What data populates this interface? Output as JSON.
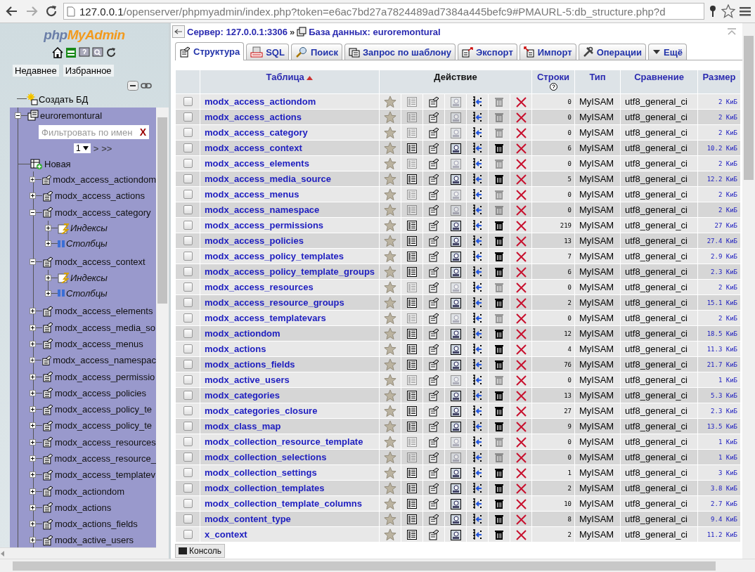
{
  "browser": {
    "url_host": "127.0.0.1",
    "url_path": "/openserver/phpmyadmin/index.php?token=e6ac7bd27a7824489ad7384a445befc9#PMAURL-5:db_structure.php?d"
  },
  "sidebar": {
    "logo_php": "php",
    "logo_myadmin": "MyAdmin",
    "links": [
      "Недавнее",
      "Избранное"
    ],
    "create_db": "Создать БД",
    "database": {
      "label": "euroremontural",
      "expanded": true,
      "filter_placeholder": "Фильтровать по имен",
      "filter_clear": "X",
      "page": "1",
      "page_next": ">",
      "page_last": ">>",
      "new_table": "Новая",
      "tables": [
        {
          "label": "modx_access_actiondom",
          "expanded": false
        },
        {
          "label": "modx_access_actions",
          "expanded": false
        },
        {
          "label": "modx_access_category",
          "expanded": true,
          "children": [
            {
              "label": "Индексы",
              "kind": "indexes",
              "expanded": false
            },
            {
              "label": "Столбцы",
              "kind": "columns",
              "expanded": false
            }
          ]
        },
        {
          "label": "modx_access_context",
          "expanded": true,
          "children": [
            {
              "label": "Индексы",
              "kind": "indexes",
              "expanded": false
            },
            {
              "label": "Столбцы",
              "kind": "columns",
              "expanded": false
            }
          ]
        },
        {
          "label": "modx_access_elements",
          "expanded": false
        },
        {
          "label": "modx_access_media_so",
          "expanded": false
        },
        {
          "label": "modx_access_menus",
          "expanded": false
        },
        {
          "label": "modx_access_namespac",
          "expanded": false
        },
        {
          "label": "modx_access_permissio",
          "expanded": false
        },
        {
          "label": "modx_access_policies",
          "expanded": false
        },
        {
          "label": "modx_access_policy_te",
          "expanded": false
        },
        {
          "label": "modx_access_policy_te",
          "expanded": false
        },
        {
          "label": "modx_access_resources",
          "expanded": false
        },
        {
          "label": "modx_access_resource_",
          "expanded": false
        },
        {
          "label": "modx_access_templatev",
          "expanded": false
        },
        {
          "label": "modx_actiondom",
          "expanded": false
        },
        {
          "label": "modx_actions",
          "expanded": false
        },
        {
          "label": "modx_actions_fields",
          "expanded": false
        },
        {
          "label": "modx_active_users",
          "expanded": false
        }
      ]
    }
  },
  "breadcrumb": {
    "server": "Сервер: 127.0.0.1:3306",
    "separator": "»",
    "database": "База данных: euroremontural"
  },
  "tabs": [
    {
      "label": "Структура",
      "kind": "structure",
      "selected": true
    },
    {
      "label": "SQL",
      "kind": "sql",
      "selected": false
    },
    {
      "label": "Поиск",
      "kind": "search",
      "selected": false
    },
    {
      "label": "Запрос по шаблону",
      "kind": "query",
      "selected": false
    },
    {
      "label": "Экспорт",
      "kind": "export",
      "selected": false
    },
    {
      "label": "Импорт",
      "kind": "import",
      "selected": false
    },
    {
      "label": "Операции",
      "kind": "operations",
      "selected": false
    },
    {
      "label": "Ещё",
      "kind": "more",
      "selected": false
    }
  ],
  "table": {
    "columns": {
      "name": "Таблица",
      "action": "Действие",
      "rows": "Строки",
      "type": "Тип",
      "collation": "Сравнение",
      "size": "Размер"
    },
    "rows": [
      {
        "name": "modx_access_actiondom",
        "empty": true,
        "rows": "0",
        "type": "MyISAM",
        "collation": "utf8_general_ci",
        "size": "2 КиБ",
        "checked": false
      },
      {
        "name": "modx_access_actions",
        "empty": true,
        "rows": "0",
        "type": "MyISAM",
        "collation": "utf8_general_ci",
        "size": "2 КиБ",
        "checked": false
      },
      {
        "name": "modx_access_category",
        "empty": true,
        "rows": "0",
        "type": "MyISAM",
        "collation": "utf8_general_ci",
        "size": "2 КиБ",
        "checked": false
      },
      {
        "name": "modx_access_context",
        "empty": false,
        "rows": "6",
        "type": "MyISAM",
        "collation": "utf8_general_ci",
        "size": "10.2 КиБ",
        "checked": false
      },
      {
        "name": "modx_access_elements",
        "empty": true,
        "rows": "0",
        "type": "MyISAM",
        "collation": "utf8_general_ci",
        "size": "2 КиБ",
        "checked": false
      },
      {
        "name": "modx_access_media_source",
        "empty": false,
        "rows": "5",
        "type": "MyISAM",
        "collation": "utf8_general_ci",
        "size": "12.2 КиБ",
        "checked": false
      },
      {
        "name": "modx_access_menus",
        "empty": true,
        "rows": "0",
        "type": "MyISAM",
        "collation": "utf8_general_ci",
        "size": "2 КиБ",
        "checked": false
      },
      {
        "name": "modx_access_namespace",
        "empty": true,
        "rows": "0",
        "type": "MyISAM",
        "collation": "utf8_general_ci",
        "size": "2 КиБ",
        "checked": false
      },
      {
        "name": "modx_access_permissions",
        "empty": false,
        "rows": "219",
        "type": "MyISAM",
        "collation": "utf8_general_ci",
        "size": "27 КиБ",
        "checked": false
      },
      {
        "name": "modx_access_policies",
        "empty": false,
        "rows": "13",
        "type": "MyISAM",
        "collation": "utf8_general_ci",
        "size": "27.4 КиБ",
        "checked": false
      },
      {
        "name": "modx_access_policy_templates",
        "empty": false,
        "rows": "7",
        "type": "MyISAM",
        "collation": "utf8_general_ci",
        "size": "2.9 КиБ",
        "checked": false
      },
      {
        "name": "modx_access_policy_template_groups",
        "empty": false,
        "rows": "6",
        "type": "MyISAM",
        "collation": "utf8_general_ci",
        "size": "2.3 КиБ",
        "checked": false
      },
      {
        "name": "modx_access_resources",
        "empty": true,
        "rows": "0",
        "type": "MyISAM",
        "collation": "utf8_general_ci",
        "size": "2 КиБ",
        "checked": false
      },
      {
        "name": "modx_access_resource_groups",
        "empty": false,
        "rows": "2",
        "type": "MyISAM",
        "collation": "utf8_general_ci",
        "size": "15.1 КиБ",
        "checked": false
      },
      {
        "name": "modx_access_templatevars",
        "empty": true,
        "rows": "0",
        "type": "MyISAM",
        "collation": "utf8_general_ci",
        "size": "2 КиБ",
        "checked": false
      },
      {
        "name": "modx_actiondom",
        "empty": false,
        "rows": "12",
        "type": "MyISAM",
        "collation": "utf8_general_ci",
        "size": "18.5 КиБ",
        "checked": false
      },
      {
        "name": "modx_actions",
        "empty": false,
        "rows": "4",
        "type": "MyISAM",
        "collation": "utf8_general_ci",
        "size": "11.3 КиБ",
        "checked": false
      },
      {
        "name": "modx_actions_fields",
        "empty": false,
        "rows": "76",
        "type": "MyISAM",
        "collation": "utf8_general_ci",
        "size": "21.7 КиБ",
        "checked": false
      },
      {
        "name": "modx_active_users",
        "empty": true,
        "rows": "0",
        "type": "MyISAM",
        "collation": "utf8_general_ci",
        "size": "1 КиБ",
        "checked": false
      },
      {
        "name": "modx_categories",
        "empty": false,
        "rows": "13",
        "type": "MyISAM",
        "collation": "utf8_general_ci",
        "size": "5.3 КиБ",
        "checked": false
      },
      {
        "name": "modx_categories_closure",
        "empty": false,
        "rows": "27",
        "type": "MyISAM",
        "collation": "utf8_general_ci",
        "size": "2.3 КиБ",
        "checked": false
      },
      {
        "name": "modx_class_map",
        "empty": false,
        "rows": "9",
        "type": "MyISAM",
        "collation": "utf8_general_ci",
        "size": "13.5 КиБ",
        "checked": false
      },
      {
        "name": "modx_collection_resource_template",
        "empty": true,
        "rows": "0",
        "type": "MyISAM",
        "collation": "utf8_general_ci",
        "size": "1 КиБ",
        "checked": false
      },
      {
        "name": "modx_collection_selections",
        "empty": true,
        "rows": "0",
        "type": "MyISAM",
        "collation": "utf8_general_ci",
        "size": "1 КиБ",
        "checked": false
      },
      {
        "name": "modx_collection_settings",
        "empty": false,
        "rows": "1",
        "type": "MyISAM",
        "collation": "utf8_general_ci",
        "size": "3 КиБ",
        "checked": false
      },
      {
        "name": "modx_collection_templates",
        "empty": false,
        "rows": "2",
        "type": "MyISAM",
        "collation": "utf8_general_ci",
        "size": "3.8 КиБ",
        "checked": false
      },
      {
        "name": "modx_collection_template_columns",
        "empty": false,
        "rows": "10",
        "type": "MyISAM",
        "collation": "utf8_general_ci",
        "size": "2.7 КиБ",
        "checked": false
      },
      {
        "name": "modx_content_type",
        "empty": false,
        "rows": "8",
        "type": "MyISAM",
        "collation": "utf8_general_ci",
        "size": "9.4 КиБ",
        "checked": false
      },
      {
        "name": "x_context",
        "empty": false,
        "rows": "2",
        "type": "MyISAM",
        "collation": "utf8_general_ci",
        "size": "11.2 КиБ",
        "checked": false
      }
    ]
  },
  "console": {
    "label": "Консоль"
  }
}
